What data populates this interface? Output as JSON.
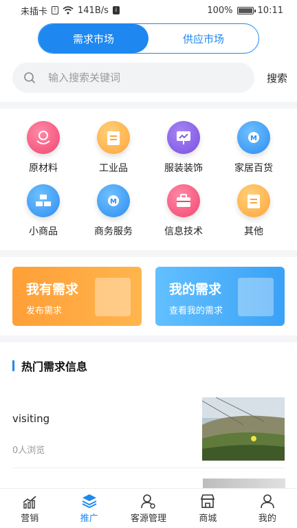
{
  "status_bar": {
    "carrier": "未插卡",
    "speed": "141B/s",
    "battery": "100%",
    "time": "10:11"
  },
  "segment": {
    "tabs": [
      {
        "label": "需求市场",
        "active": true
      },
      {
        "label": "供应市场",
        "active": false
      }
    ]
  },
  "search": {
    "placeholder": "输入搜索关键词",
    "button_label": "搜索"
  },
  "categories": [
    {
      "label": "原材料",
      "icon": "globe-hand-icon",
      "color": "#f2456e"
    },
    {
      "label": "工业品",
      "icon": "clipboard-icon",
      "color": "#ffa33a"
    },
    {
      "label": "服装装饰",
      "icon": "presentation-icon",
      "color": "#7a4fe0"
    },
    {
      "label": "家居百货",
      "icon": "lightbulb-m-icon",
      "color": "#2d8cf0"
    },
    {
      "label": "小商品",
      "icon": "gold-bars-icon",
      "color": "#2d8cf0"
    },
    {
      "label": "商务服务",
      "icon": "lightbulb-m-icon",
      "color": "#2d8cf0"
    },
    {
      "label": "信息技术",
      "icon": "briefcase-icon",
      "color": "#f2456e"
    },
    {
      "label": "其他",
      "icon": "clipboard-icon",
      "color": "#ffa33a"
    }
  ],
  "cards": {
    "publish": {
      "title": "我有需求",
      "subtitle": "发布需求"
    },
    "mine": {
      "title": "我的需求",
      "subtitle": "查看我的需求"
    }
  },
  "hot": {
    "title": "热门需求信息",
    "items": [
      {
        "name": "visiting",
        "views": "0人浏览"
      }
    ]
  },
  "tabbar": {
    "tabs": [
      {
        "label": "营销",
        "icon": "chart-icon",
        "active": false
      },
      {
        "label": "推广",
        "icon": "layers-icon",
        "active": true
      },
      {
        "label": "客源管理",
        "icon": "user-gear-icon",
        "active": false
      },
      {
        "label": "商城",
        "icon": "store-icon",
        "active": false
      },
      {
        "label": "我的",
        "icon": "person-icon",
        "active": false
      }
    ]
  },
  "colors": {
    "accent": "#1e88f0",
    "orange_card": "#ff9f37",
    "blue_card": "#3aa1f5"
  }
}
